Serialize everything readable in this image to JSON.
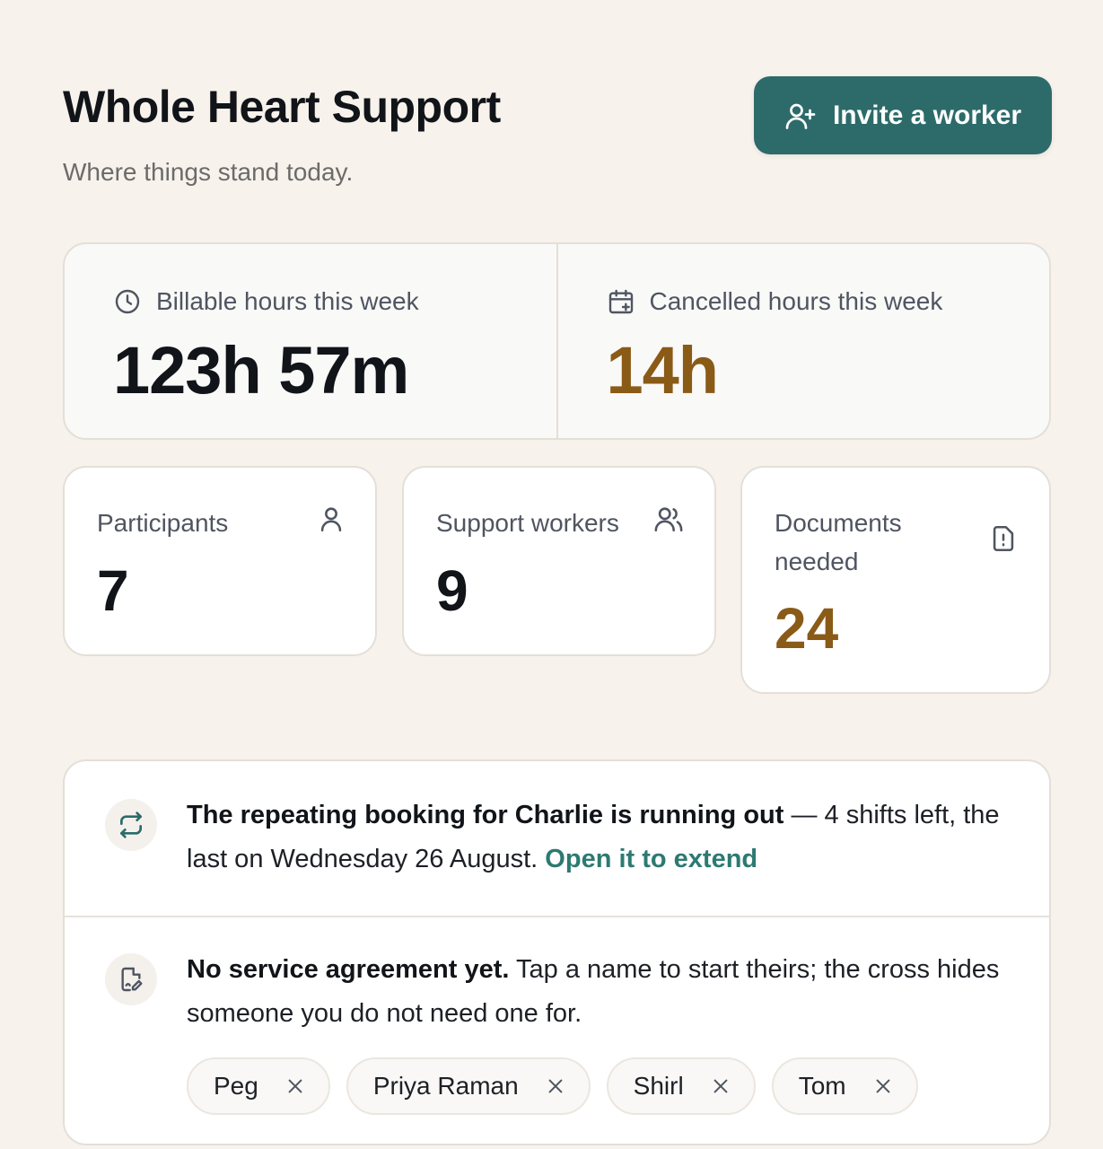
{
  "header": {
    "title": "Whole Heart Support",
    "subtitle": "Where things stand today.",
    "invite_label": "Invite a worker"
  },
  "hours": {
    "billable_label": "Billable hours this week",
    "billable_value": "123h 57m",
    "cancelled_label": "Cancelled hours this week",
    "cancelled_value": "14h"
  },
  "stats": {
    "participants_label": "Participants",
    "participants_value": "7",
    "workers_label": "Support workers",
    "workers_value": "9",
    "documents_label": "Documents needed",
    "documents_value": "24"
  },
  "notices": {
    "booking_bold": "The repeating booking for Charlie is running out",
    "booking_rest": " — 4 shifts left, the last on Wednesday 26 August. ",
    "booking_link": "Open it to extend",
    "agreement_bold": "No service agreement yet.",
    "agreement_rest": " Tap a name to start theirs; the cross hides someone you do not need one for.",
    "people": [
      "Peg",
      "Priya Raman",
      "Shirl",
      "Tom"
    ]
  },
  "colors": {
    "accent": "#2c6b6a",
    "warning_amber": "#8a5a17",
    "background": "#f7f2ec"
  },
  "icons": {
    "invite": "user-plus-icon",
    "billable": "clock-icon",
    "cancelled": "calendar-plus-icon",
    "participants": "user-icon",
    "workers": "users-icon",
    "documents": "file-alert-icon",
    "booking": "repeat-icon",
    "agreement": "file-signature-icon",
    "dismiss": "close-icon"
  }
}
